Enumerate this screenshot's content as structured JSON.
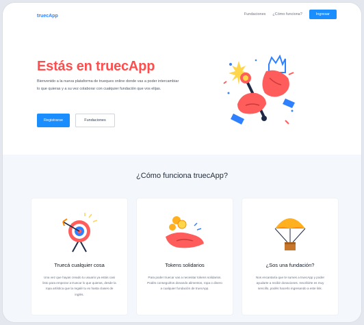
{
  "header": {
    "logo": "truecApp",
    "nav": [
      "Fundaciones",
      "¿Cómo funciona?"
    ],
    "cta": "Ingresar"
  },
  "hero": {
    "title": "Estás en truecApp",
    "description": "Bienvenido a la nueva plataforma de trueques online donde vas a poder intercambiar lo que quieras y a su vez colaborar con cualquier fundación que vos elijas.",
    "primary_button": "Registrarse",
    "secondary_button": "Fundaciones"
  },
  "how": {
    "title": "¿Cómo funciona truecApp?",
    "cards": [
      {
        "title": "Truecá cualquier cosa",
        "text": "Una vez que hayas creado tu usuario ya estás casi listo para empezar a truecar lo que quieras, desde la ropa artística que la regalé tu ex hasta clases de inglés."
      },
      {
        "title": "Tokens solidarios",
        "text": "Para poder truecar vas a necesitar tokens solidarios. Podés conseguirlos donando alimentos, ropa o dinero a cualquier fundación de truecApp."
      },
      {
        "title": "¿Sos una fundación?",
        "text": "Nos encantaría que te sumes a truecApp y poder ayudarte a recibir donaciones. Inscribirte es muy sencillo, podés hacerlo ingresando a este link."
      }
    ]
  },
  "colors": {
    "accent": "#1a8dff",
    "title_red": "#ff4d4d",
    "section_bg": "#f4f7fb"
  }
}
